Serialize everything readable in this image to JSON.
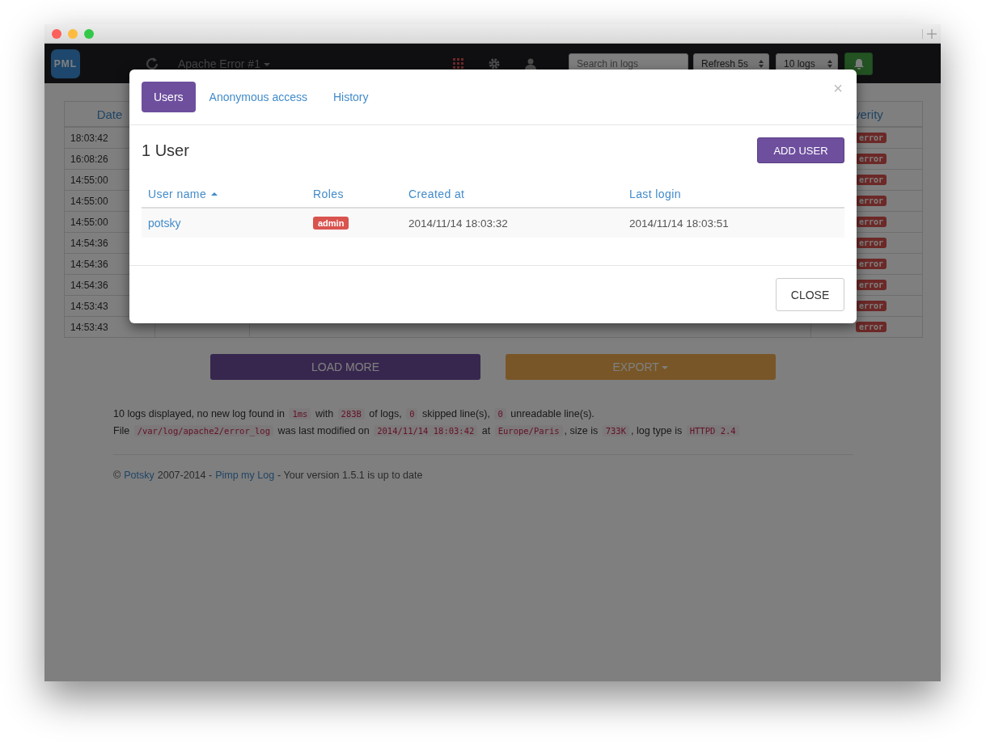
{
  "navbar": {
    "logo_text": "PML",
    "log_title": "Apache Error #1",
    "search": {
      "placeholder": "Search in logs"
    },
    "refresh_select": "Refresh 5s",
    "count_select": "10 logs"
  },
  "log_table": {
    "columns": [
      "Date",
      "verity"
    ],
    "rows": [
      {
        "date": "18:03:42",
        "severity": "error"
      },
      {
        "date": "16:08:26",
        "severity": "error"
      },
      {
        "date": "14:55:00",
        "severity": "error"
      },
      {
        "date": "14:55:00",
        "severity": "error"
      },
      {
        "date": "14:55:00",
        "severity": "error"
      },
      {
        "date": "14:54:36",
        "severity": "error"
      },
      {
        "date": "14:54:36",
        "severity": "error"
      },
      {
        "date": "14:54:36",
        "severity": "error"
      },
      {
        "date": "14:53:43",
        "severity": "error"
      },
      {
        "date": "14:53:43",
        "severity": "error"
      }
    ]
  },
  "actions": {
    "load_more": "LOAD MORE",
    "export": "EXPORT"
  },
  "status_lines": [
    [
      {
        "kind": "text",
        "text": "10 logs displayed, no new log found in "
      },
      {
        "kind": "code",
        "text": "1ms"
      },
      {
        "kind": "text",
        "text": " with "
      },
      {
        "kind": "code",
        "text": "283B"
      },
      {
        "kind": "text",
        "text": " of logs, "
      },
      {
        "kind": "code",
        "text": "0"
      },
      {
        "kind": "text",
        "text": " skipped line(s), "
      },
      {
        "kind": "code",
        "text": "0"
      },
      {
        "kind": "text",
        "text": " unreadable line(s)."
      }
    ],
    [
      {
        "kind": "text",
        "text": "File "
      },
      {
        "kind": "code",
        "text": "/var/log/apache2/error_log"
      },
      {
        "kind": "text",
        "text": " was last modified on "
      },
      {
        "kind": "code",
        "text": "2014/11/14 18:03:42"
      },
      {
        "kind": "text",
        "text": " at "
      },
      {
        "kind": "code",
        "text": "Europe/Paris"
      },
      {
        "kind": "text",
        "text": ", size is "
      },
      {
        "kind": "code",
        "text": "733K"
      },
      {
        "kind": "text",
        "text": ", log type is "
      },
      {
        "kind": "code",
        "text": "HTTPD 2.4"
      }
    ]
  ],
  "footer": {
    "copyright": "©",
    "author_link": "Potsky",
    "years": "2007-2014 -",
    "product_link": "Pimp my Log",
    "version_text": "- Your version 1.5.1 is up to date"
  },
  "modal": {
    "tabs": [
      {
        "label": "Users",
        "selected": true
      },
      {
        "label": "Anonymous access",
        "selected": false
      },
      {
        "label": "History",
        "selected": false
      }
    ],
    "close_icon": "×",
    "heading": "1 User",
    "add_button": "ADD USER",
    "columns": [
      {
        "label": "User name",
        "sorted": true
      },
      {
        "label": "Roles",
        "sorted": false
      },
      {
        "label": "Created at",
        "sorted": false
      },
      {
        "label": "Last login",
        "sorted": false
      }
    ],
    "users": [
      {
        "name": "potsky",
        "role": "admin",
        "created": "2014/11/14 18:03:32",
        "last_login": "2014/11/14 18:03:51"
      }
    ],
    "close_button": "CLOSE"
  }
}
